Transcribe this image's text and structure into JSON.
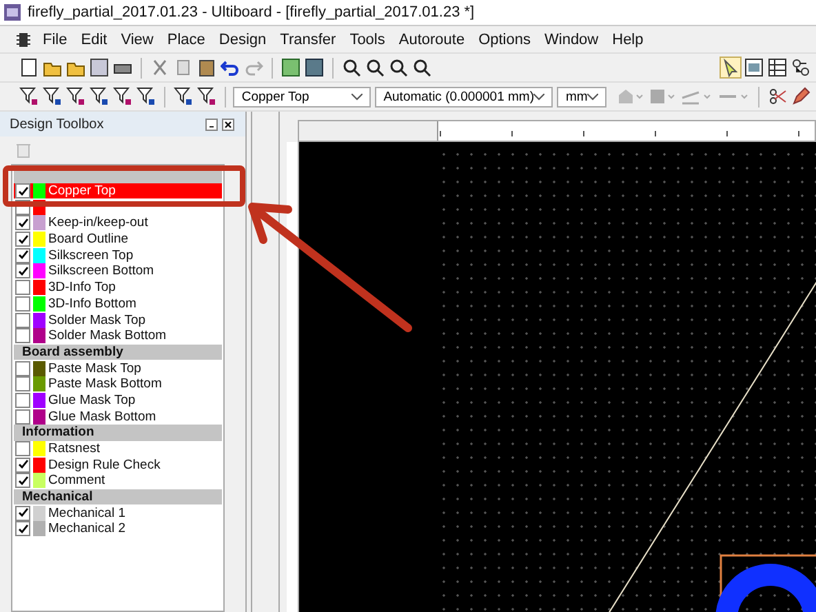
{
  "window": {
    "title": "firefly_partial_2017.01.23 - Ultiboard - [firefly_partial_2017.01.23 *]"
  },
  "menu": [
    "File",
    "Edit",
    "View",
    "Place",
    "Design",
    "Transfer",
    "Tools",
    "Autoroute",
    "Options",
    "Window",
    "Help"
  ],
  "toolbar": {
    "layer_dropdown": "Copper Top",
    "grid_dropdown": "Automatic (0.000001 mm)",
    "unit_dropdown": "mm"
  },
  "toolbox": {
    "title": "Design Toolbox",
    "groups": [
      {
        "layers": [
          {
            "label": "Copper Top",
            "checked": true,
            "color": "#00ff00",
            "selected": true
          },
          {
            "color": "#ff0000",
            "selected": false
          },
          {
            "label": "Keep-in/keep-out",
            "checked": true,
            "color": "#c8a0d0",
            "selected": false
          },
          {
            "label": "Board Outline",
            "checked": true,
            "color": "#ffff00",
            "selected": false
          },
          {
            "label": "Silkscreen Top",
            "checked": true,
            "color": "#00ffff",
            "selected": false
          },
          {
            "label": "Silkscreen Bottom",
            "checked": true,
            "color": "#ff00ff",
            "selected": false
          },
          {
            "label": "3D-Info Top",
            "checked": false,
            "color": "#ff0000",
            "selected": false
          },
          {
            "label": "3D-Info Bottom",
            "checked": false,
            "color": "#00ff00",
            "selected": false
          },
          {
            "label": "Solder Mask Top",
            "checked": false,
            "color": "#a000ff",
            "selected": false
          },
          {
            "label": "Solder Mask Bottom",
            "checked": false,
            "color": "#b0008a",
            "selected": false
          }
        ]
      },
      {
        "title": "Board assembly",
        "layers": [
          {
            "label": "Paste Mask Top",
            "checked": false,
            "color": "#5a5a00",
            "selected": false
          },
          {
            "label": "Paste Mask Bottom",
            "checked": false,
            "color": "#6a9a00",
            "selected": false
          },
          {
            "label": "Glue Mask Top",
            "checked": false,
            "color": "#a000ff",
            "selected": false
          },
          {
            "label": "Glue Mask Bottom",
            "checked": false,
            "color": "#b0008a",
            "selected": false
          }
        ]
      },
      {
        "title": "Information",
        "layers": [
          {
            "label": "Ratsnest",
            "checked": false,
            "color": "#ffff00",
            "selected": false
          },
          {
            "label": "Design Rule Check",
            "checked": true,
            "color": "#ff0000",
            "selected": false
          },
          {
            "label": "Comment",
            "checked": true,
            "color": "#c8ff60",
            "selected": false
          }
        ]
      },
      {
        "title": "Mechanical",
        "layers": [
          {
            "label": "Mechanical 1",
            "checked": true,
            "color": "#d0d0d0",
            "selected": false
          },
          {
            "label": "Mechanical 2",
            "checked": true,
            "color": "#b0b0b0",
            "selected": false
          }
        ]
      }
    ]
  }
}
